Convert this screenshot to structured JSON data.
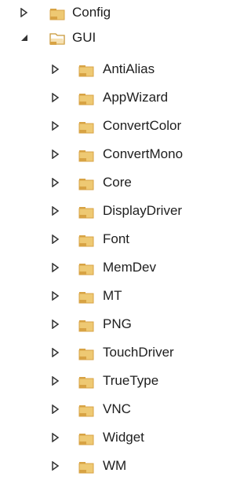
{
  "tree": {
    "root_items": [
      {
        "label": "Config",
        "expanded": false
      },
      {
        "label": "GUI",
        "expanded": true
      }
    ],
    "gui_children": [
      "AntiAlias",
      "AppWizard",
      "ConvertColor",
      "ConvertMono",
      "Core",
      "DisplayDriver",
      "Font",
      "MemDev",
      "MT",
      "PNG",
      "TouchDriver",
      "TrueType",
      "VNC",
      "Widget",
      "WM"
    ]
  },
  "colors": {
    "folder_tab": "#d8a344",
    "folder_body": "#eec973",
    "folder_open_outline": "#c89636",
    "arrow_collapsed_stroke": "#333333",
    "arrow_expanded_fill": "#333333"
  },
  "icons": {
    "collapsed": "chevron-right-outline-icon",
    "expanded": "triangle-down-filled-icon",
    "folder_closed": "folder-icon",
    "folder_open": "folder-open-icon"
  }
}
